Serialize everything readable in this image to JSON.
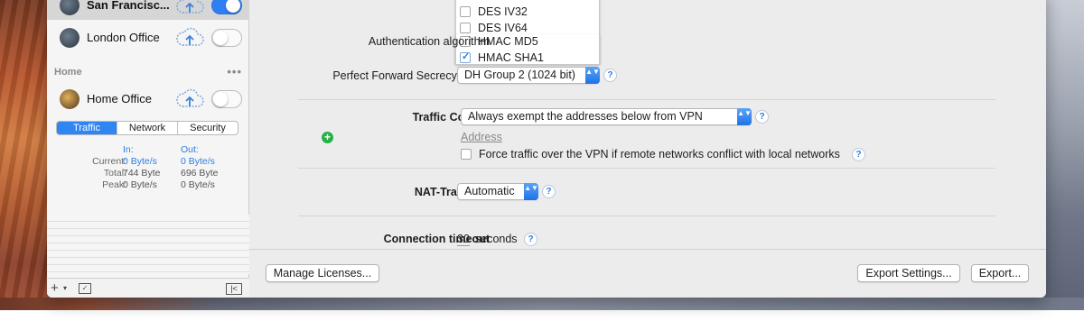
{
  "sidebar": {
    "connections": [
      {
        "name": "San Francisc...",
        "enabled": true,
        "selected": true
      },
      {
        "name": "London Office",
        "enabled": false,
        "selected": false
      }
    ],
    "group": {
      "name": "Home",
      "more": "•••"
    },
    "home_connections": [
      {
        "name": "Home Office",
        "enabled": false
      }
    ],
    "tabs": [
      "Traffic",
      "Network",
      "Security"
    ],
    "active_tab": "Traffic",
    "stats": {
      "in_header": "In:",
      "out_header": "Out:",
      "rows": [
        {
          "label": "Current:",
          "in": "0 Byte/s",
          "out": "0 Byte/s"
        },
        {
          "label": "Total:",
          "in": "744 Byte",
          "out": "696 Byte"
        },
        {
          "label": "Peak:",
          "in": "0 Byte/s",
          "out": "0 Byte/s"
        }
      ]
    },
    "footer": {
      "add": "+",
      "caret": "▾",
      "menu": "✓",
      "collapse": "|<"
    }
  },
  "settings": {
    "encryption_options": [
      {
        "label": "DES IV32",
        "checked": false
      },
      {
        "label": "DES IV64",
        "checked": false
      }
    ],
    "auth_label": "Authentication algorithm",
    "auth_options": [
      {
        "label": "HMAC MD5",
        "checked": false
      },
      {
        "label": "HMAC SHA1",
        "checked": true
      }
    ],
    "pfs_label": "Perfect Forward Secrecy (PFS)",
    "pfs_value": "DH Group 2 (1024 bit)",
    "traffic_label": "Traffic Control",
    "traffic_value": "Always exempt the addresses below from VPN",
    "address_header": "Address",
    "force_label": "Force traffic over the VPN if remote networks conflict with local networks",
    "force_checked": false,
    "nat_label": "NAT-Traversal",
    "nat_value": "Automatic",
    "timeout_label": "Connection timeout",
    "timeout_value": "30",
    "timeout_unit": "seconds",
    "help": "?",
    "add_symbol": "+",
    "stepper": "▲▼"
  },
  "buttons": {
    "manage": "Manage Licenses...",
    "export_settings": "Export Settings...",
    "export": "Export..."
  },
  "colors": {
    "accent": "#2f7de1",
    "toggle_on": "#2e7ff2",
    "add_green": "#26b145"
  }
}
